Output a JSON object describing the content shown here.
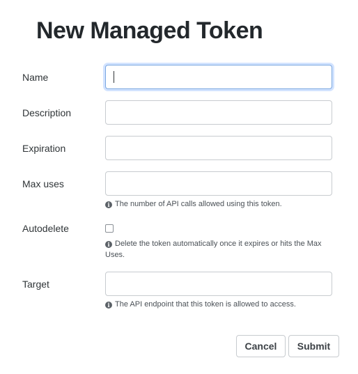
{
  "form": {
    "title": "New Managed Token",
    "fields": {
      "name": {
        "label": "Name",
        "value": ""
      },
      "description": {
        "label": "Description",
        "value": ""
      },
      "expiration": {
        "label": "Expiration",
        "value": ""
      },
      "max_uses": {
        "label": "Max uses",
        "value": "",
        "help": "The number of API calls allowed using this token."
      },
      "autodelete": {
        "label": "Autodelete",
        "checked": false,
        "help": "Delete the token automatically once it expires or hits the Max Uses."
      },
      "target": {
        "label": "Target",
        "value": "",
        "help": "The API endpoint that this token is allowed to access."
      }
    },
    "actions": {
      "cancel_label": "Cancel",
      "submit_label": "Submit"
    },
    "icons": {
      "info": "info-circle-icon"
    }
  }
}
